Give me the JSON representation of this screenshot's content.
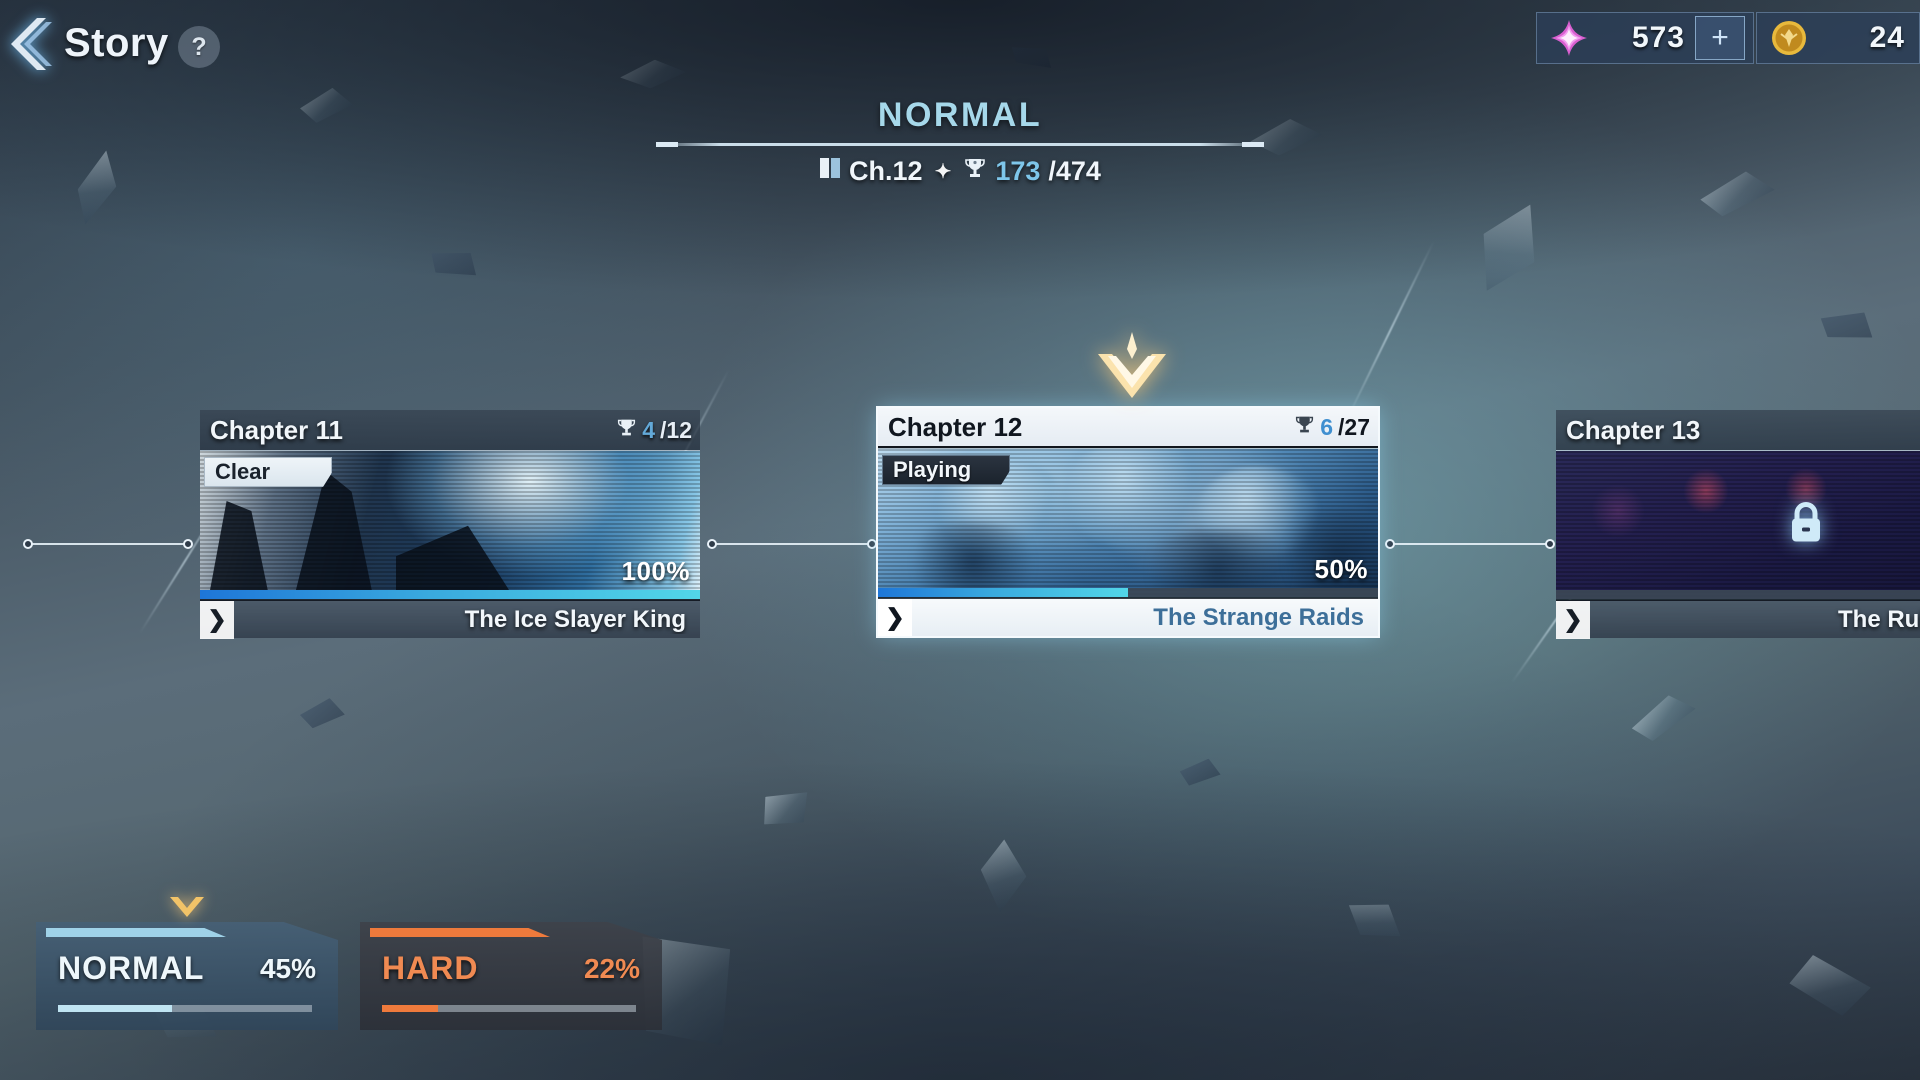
{
  "header": {
    "back_icon": "chevron-left-icon",
    "title": "Story",
    "help_label": "?"
  },
  "currency": [
    {
      "icon": "gem-star-icon",
      "name": "gem",
      "value": "573",
      "accent": "#e06fe0",
      "add_label": "+"
    },
    {
      "icon": "gold-coin-icon",
      "name": "gold",
      "value": "24",
      "accent": "#e8b93c"
    }
  ],
  "difficulty_header": {
    "name": "NORMAL",
    "chapter_icon": "book-icon",
    "chapter_label": "Ch.12",
    "separator_icon": "sparkle-icon",
    "trophy_icon": "trophy-icon",
    "trophy_current": "173",
    "trophy_total": "/474"
  },
  "current_marker_icon": "current-chapter-marker-icon",
  "chapters": [
    {
      "name": "Chapter 11",
      "trophy_icon": "trophy-icon",
      "trophy_current": "4",
      "trophy_total": "/12",
      "status": "Clear",
      "status_kind": "clear",
      "progress_pct": "100%",
      "progress_value": 100,
      "title": "The Ice Slayer King",
      "arrow_icon": "chevron-right-icon",
      "locked": false,
      "active": false
    },
    {
      "name": "Chapter 12",
      "trophy_icon": "trophy-icon",
      "trophy_current": "6",
      "trophy_total": "/27",
      "status": "Playing",
      "status_kind": "playing",
      "progress_pct": "50%",
      "progress_value": 50,
      "title": "The Strange Raids",
      "arrow_icon": "chevron-right-icon",
      "locked": false,
      "active": true
    },
    {
      "name": "Chapter 13",
      "trophy_icon": "",
      "trophy_current": "",
      "trophy_total": "",
      "status": "",
      "status_kind": "locked",
      "progress_pct": "",
      "progress_value": 0,
      "title": "The Ruler of the L",
      "arrow_icon": "chevron-right-icon",
      "lock_icon": "lock-icon",
      "locked": true,
      "active": false
    }
  ],
  "difficulty_tabs": [
    {
      "label": "NORMAL",
      "pct": "45%",
      "value": 45,
      "selected": true,
      "accent": "#bfe4f2"
    },
    {
      "label": "HARD",
      "pct": "22%",
      "value": 22,
      "selected": false,
      "accent": "#ee7a3c"
    }
  ],
  "selected_tab_pointer_icon": "chevron-down-marker-icon"
}
